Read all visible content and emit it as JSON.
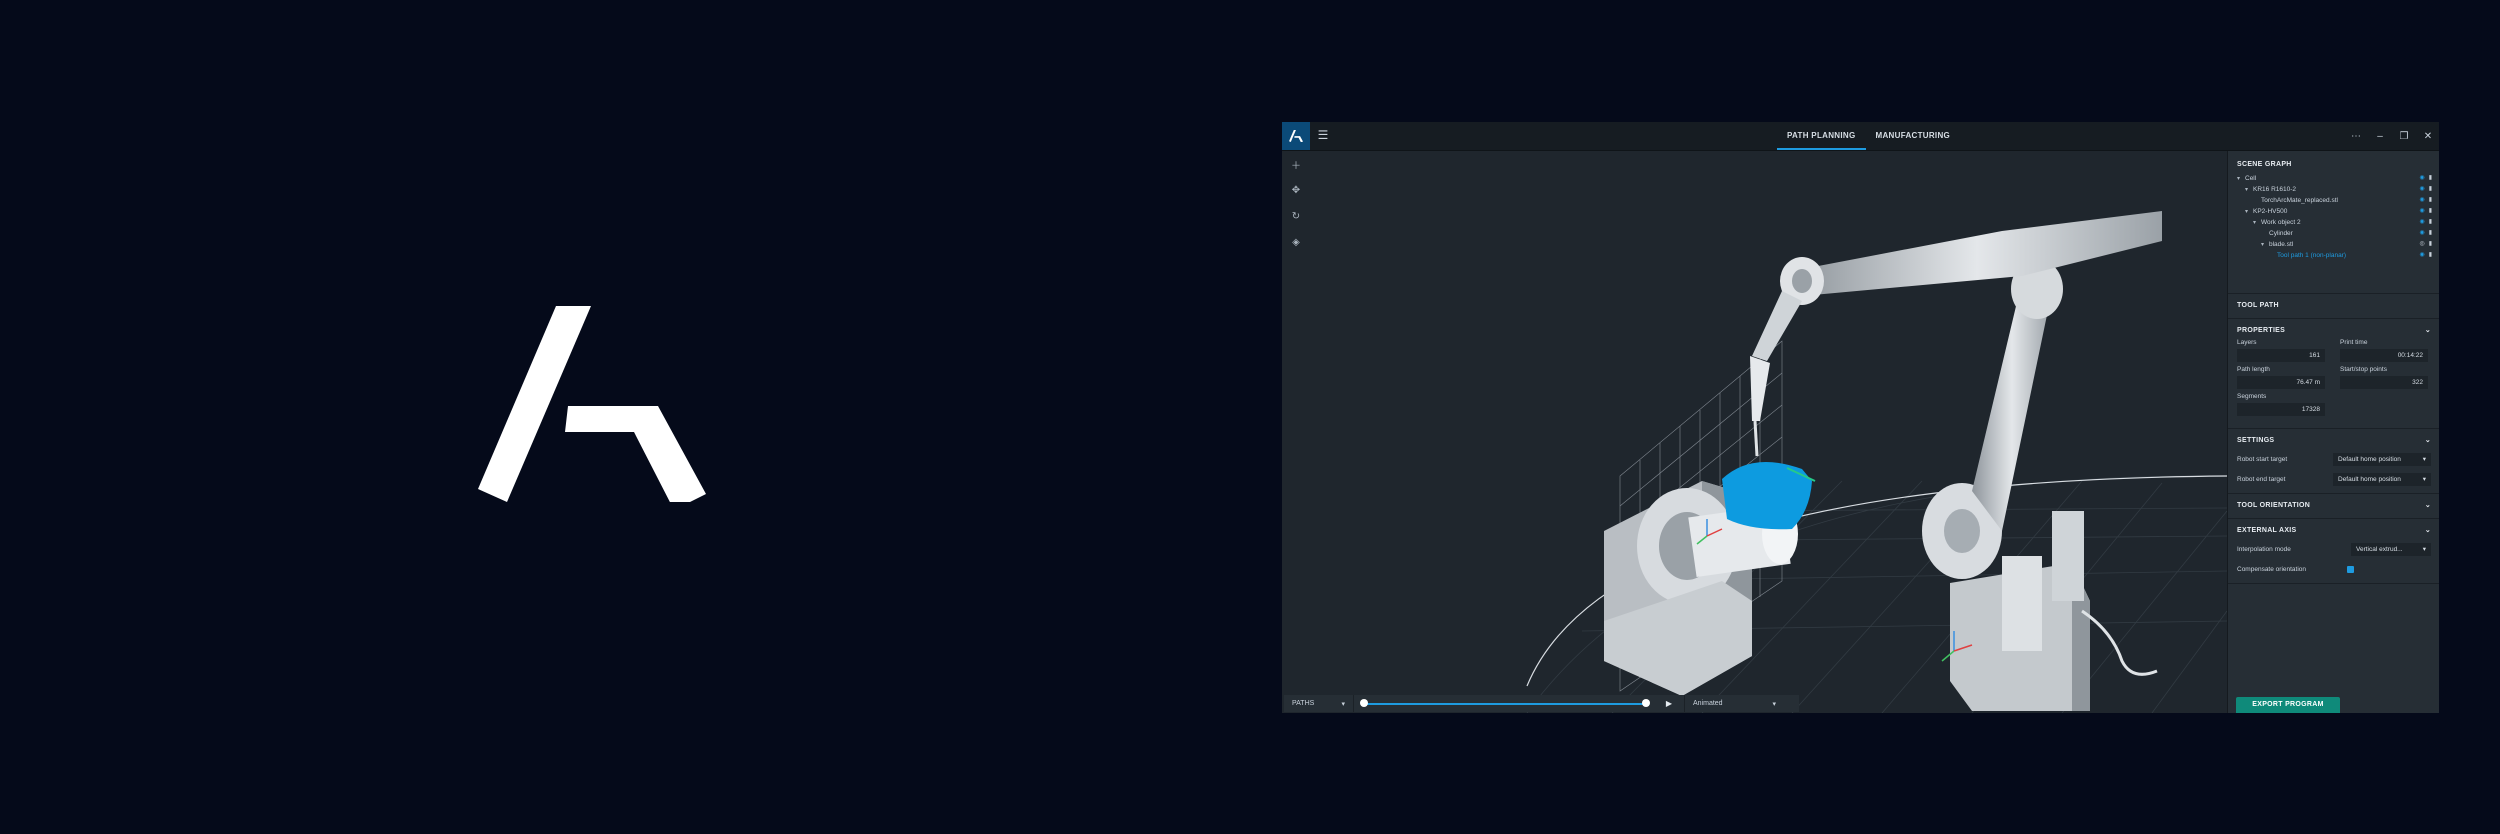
{
  "brand": {
    "logo_icon": "brand-logo-icon"
  },
  "titlebar": {
    "tabs": [
      {
        "label": "PATH PLANNING",
        "active": true
      },
      {
        "label": "MANUFACTURING",
        "active": false
      }
    ],
    "window_controls": [
      "more-icon",
      "minimize-icon",
      "restore-icon",
      "close-icon"
    ],
    "menu_icon": "hamburger-icon"
  },
  "toolbar": {
    "tools": [
      "add-icon",
      "move-icon",
      "rotate-icon",
      "layers-icon"
    ]
  },
  "scene_graph": {
    "title": "SCENE GRAPH",
    "items": [
      {
        "label": "Cell"
      },
      {
        "label": "KR16 R1610-2"
      },
      {
        "label": "TorchArcMate_replaced.stl"
      },
      {
        "label": "KP2-HV500"
      },
      {
        "label": "Work object 2"
      },
      {
        "label": "Cylinder"
      },
      {
        "label": "blade.stl"
      },
      {
        "label": "Tool path 1 (non-planar)"
      }
    ]
  },
  "tool_path": {
    "title": "TOOL PATH"
  },
  "properties": {
    "title": "PROPERTIES",
    "layers_label": "Layers",
    "layers_value": "161",
    "print_time_label": "Print time",
    "print_time_value": "00:14:22",
    "path_length_label": "Path length",
    "path_length_value": "76.47 m",
    "start_stop_label": "Start/stop points",
    "start_stop_value": "322",
    "segments_label": "Segments",
    "segments_value": "17328"
  },
  "settings": {
    "title": "SETTINGS",
    "robot_start_label": "Robot start target",
    "robot_start_value": "Default home position",
    "robot_end_label": "Robot end target",
    "robot_end_value": "Default home position"
  },
  "tool_orientation": {
    "title": "TOOL ORIENTATION"
  },
  "external_axis": {
    "title": "EXTERNAL AXIS",
    "interp_label": "Interpolation mode",
    "interp_value": "Vertical extrud...",
    "compensate_label": "Compensate orientation",
    "compensate_checked": true
  },
  "export_button": "EXPORT PROGRAM",
  "bottombar": {
    "paths_label": "PATHS",
    "slider_start": 0,
    "slider_end": 1,
    "mode_label": "Animated"
  },
  "colors": {
    "accent": "#1e9be0",
    "export": "#0f8a7a",
    "background": "#050a1a",
    "panel": "#262e35",
    "viewport": "#1f262d"
  }
}
